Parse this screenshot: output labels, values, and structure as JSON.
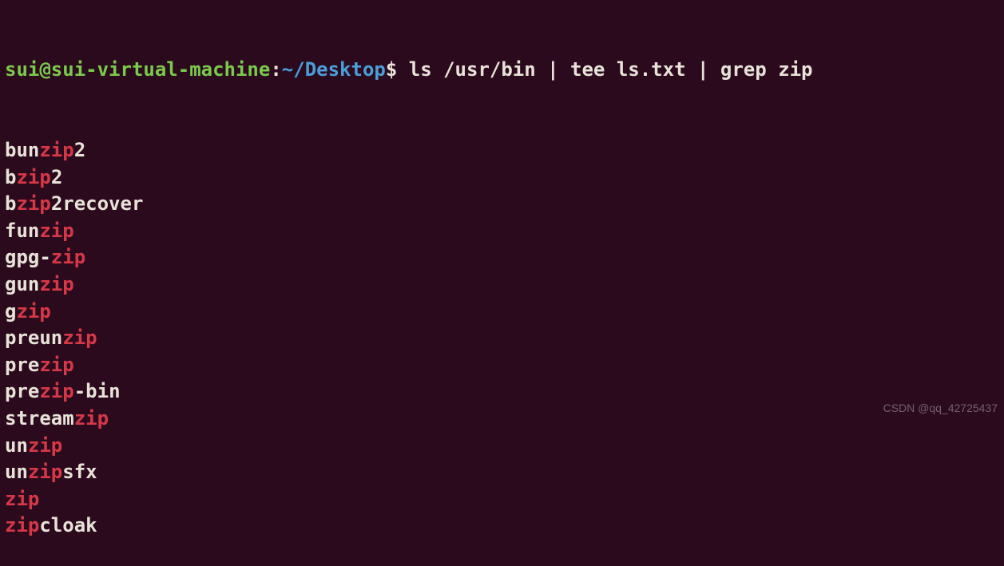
{
  "prompt": {
    "user_host": "sui@sui-virtual-machine",
    "sep": ":",
    "path": "~/Desktop",
    "dollar": "$",
    "command": " ls /usr/bin | tee ls.txt | grep zip"
  },
  "highlight": "zip",
  "output": [
    "bunzip2",
    "bzip2",
    "bzip2recover",
    "funzip",
    "gpg-zip",
    "gunzip",
    "gzip",
    "preunzip",
    "prezip",
    "prezip-bin",
    "streamzip",
    "unzip",
    "unzipsfx",
    "zip",
    "zipcloak"
  ],
  "watermark": "CSDN @qq_42725437"
}
